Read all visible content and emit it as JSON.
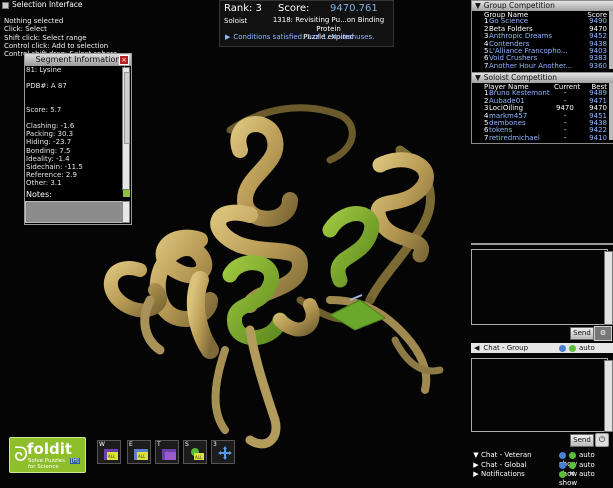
{
  "selection": {
    "title": "Selection Interface",
    "lines": [
      "Nothing selected",
      "Click: Select",
      "Shift click: Select range",
      "Control click: Add to selection",
      "Control shift drag: Select sphere"
    ]
  },
  "segment": {
    "title": "Segment Information",
    "lines": [
      "81: Lysine",
      "",
      "PDB#: A 87",
      "",
      "",
      "Score: 5.7",
      "",
      "Clashing: -1.6",
      "Packing: 30.3",
      "Hiding: -23.7",
      "Bonding: 7.5",
      "Ideality: -1.4",
      "Sidechain: -11.5",
      "Reference: 2.9",
      "Other: 3.1"
    ],
    "notes_label": "Notes:"
  },
  "scorebox": {
    "rank_label": "Rank: 3",
    "score_label": "Score:",
    "score_value": "9470.761",
    "mode": "Soloist",
    "puzzle_line1": "1318: Revisiting Pu...on Binding Protein",
    "puzzle_line2": "Puzzle expired",
    "conditions": "Conditions satisfied: 1 of 1. No bonuses."
  },
  "group_competition": {
    "title": "Group Competition",
    "col_name": "Group Name",
    "col_score": "Score",
    "rows": [
      {
        "rank": "1",
        "name": "Go Science",
        "score": "9490"
      },
      {
        "rank": "2",
        "name": "Beta Folders",
        "score": "9470"
      },
      {
        "rank": "3",
        "name": "Anthropic Dreams",
        "score": "9452"
      },
      {
        "rank": "4",
        "name": "Contenders",
        "score": "9438"
      },
      {
        "rank": "5",
        "name": "L'Alliance Francopho...",
        "score": "9403"
      },
      {
        "rank": "6",
        "name": "Void Crushers",
        "score": "9383"
      },
      {
        "rank": "7",
        "name": "Another Hour Another...",
        "score": "9360"
      }
    ]
  },
  "soloist_competition": {
    "title": "Soloist Competition",
    "col_name": "Player Name",
    "col_current": "Current",
    "col_best": "Best",
    "rows": [
      {
        "rank": "1",
        "name": "Bruno Kestemont",
        "current": "-",
        "best": "9489"
      },
      {
        "rank": "2",
        "name": "Aubade01",
        "current": "-",
        "best": "9471"
      },
      {
        "rank": "3",
        "name": "LociOiling",
        "current": "9470",
        "best": "9470"
      },
      {
        "rank": "4",
        "name": "markm457",
        "current": "-",
        "best": "9451"
      },
      {
        "rank": "5",
        "name": "dembones",
        "current": "-",
        "best": "9438"
      },
      {
        "rank": "6",
        "name": "tokens",
        "current": "-",
        "best": "9422"
      },
      {
        "rank": "7",
        "name": "retiredmichael",
        "current": "-",
        "best": "9410"
      }
    ]
  },
  "chat": {
    "send_label": "Send",
    "group_label": "Chat - Group",
    "veteran_label": "Chat - Veteran",
    "global_label": "Chat - Global",
    "notifications_label": "Notifications",
    "auto_show": "auto show"
  },
  "logo": {
    "name": "foldit",
    "tagline1": "Solve Puzzles",
    "tagline2": "for Science",
    "badge": "[H]"
  },
  "tools": [
    {
      "key": "W",
      "icon": "wiggle-icon"
    },
    {
      "key": "E",
      "icon": "shake-icon"
    },
    {
      "key": "T",
      "icon": "tweak-icon"
    },
    {
      "key": "S",
      "icon": "shake-sidechains-icon"
    },
    {
      "key": "3",
      "icon": "move-icon"
    }
  ],
  "colors": {
    "accent_blue": "#8fb8ff",
    "foldit_green": "#8fbe2b",
    "protein_tan": "#c9b06a",
    "protein_green": "#7fb02e"
  }
}
